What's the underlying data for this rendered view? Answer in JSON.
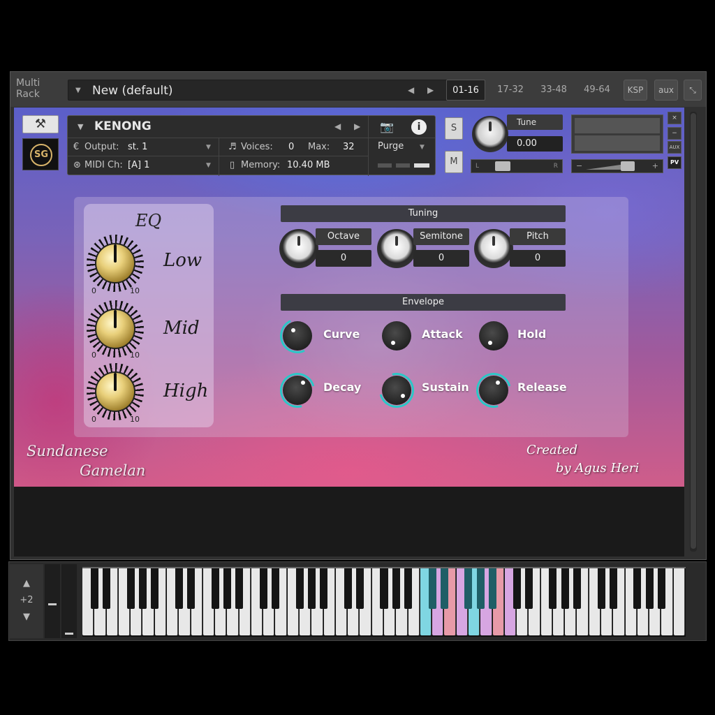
{
  "rack": {
    "label": "Multi\nRack",
    "preset_name": "New (default)",
    "tabs": [
      {
        "label": "01-16",
        "active": true
      },
      {
        "label": "17-32",
        "active": false
      },
      {
        "label": "33-48",
        "active": false
      },
      {
        "label": "49-64",
        "active": false
      }
    ],
    "ksp_label": "KSP",
    "aux_label": "aux"
  },
  "instrument": {
    "name": "KENONG",
    "output_label": "Output:",
    "output_value": "st. 1",
    "midi_label": "MIDI Ch:",
    "midi_value": "[A] 1",
    "voices_label": "Voices:",
    "voices_value": "0",
    "max_label": "Max:",
    "max_value": "32",
    "memory_label": "Memory:",
    "memory_value": "10.40 MB",
    "purge_label": "Purge",
    "solo_label": "S",
    "mute_label": "M",
    "tune_label": "Tune",
    "tune_value": "0.00",
    "pan_left": "L",
    "pan_right": "R",
    "vol_minus": "−",
    "vol_plus": "+",
    "side_buttons": {
      "close": "×",
      "min": "−",
      "aux": "AUX",
      "pv": "PV"
    },
    "logo_text": "SG"
  },
  "eq": {
    "title": "EQ",
    "bands": [
      {
        "label": "Low",
        "min": "0",
        "max": "10"
      },
      {
        "label": "Mid",
        "min": "0",
        "max": "10"
      },
      {
        "label": "High",
        "min": "0",
        "max": "10"
      }
    ]
  },
  "tuning": {
    "title": "Tuning",
    "params": [
      {
        "label": "Octave",
        "value": "0"
      },
      {
        "label": "Semitone",
        "value": "0"
      },
      {
        "label": "Pitch",
        "value": "0"
      }
    ]
  },
  "envelope": {
    "title": "Envelope",
    "params": [
      {
        "label": "Curve"
      },
      {
        "label": "Attack"
      },
      {
        "label": "Hold"
      },
      {
        "label": "Decay"
      },
      {
        "label": "Sustain"
      },
      {
        "label": "Release"
      }
    ]
  },
  "branding": {
    "title_line1": "Sundanese",
    "title_line2": "Gamelan",
    "credit_line1": "Created",
    "credit_line2": "by Agus Heri"
  },
  "keyboard": {
    "octave_offset": "+2",
    "colors": {
      "cyan": "#7fd6e2",
      "pink": "#e79aa8",
      "violet": "#d7a6e2",
      "white": "#e8e8e8",
      "black": "#151515"
    }
  }
}
